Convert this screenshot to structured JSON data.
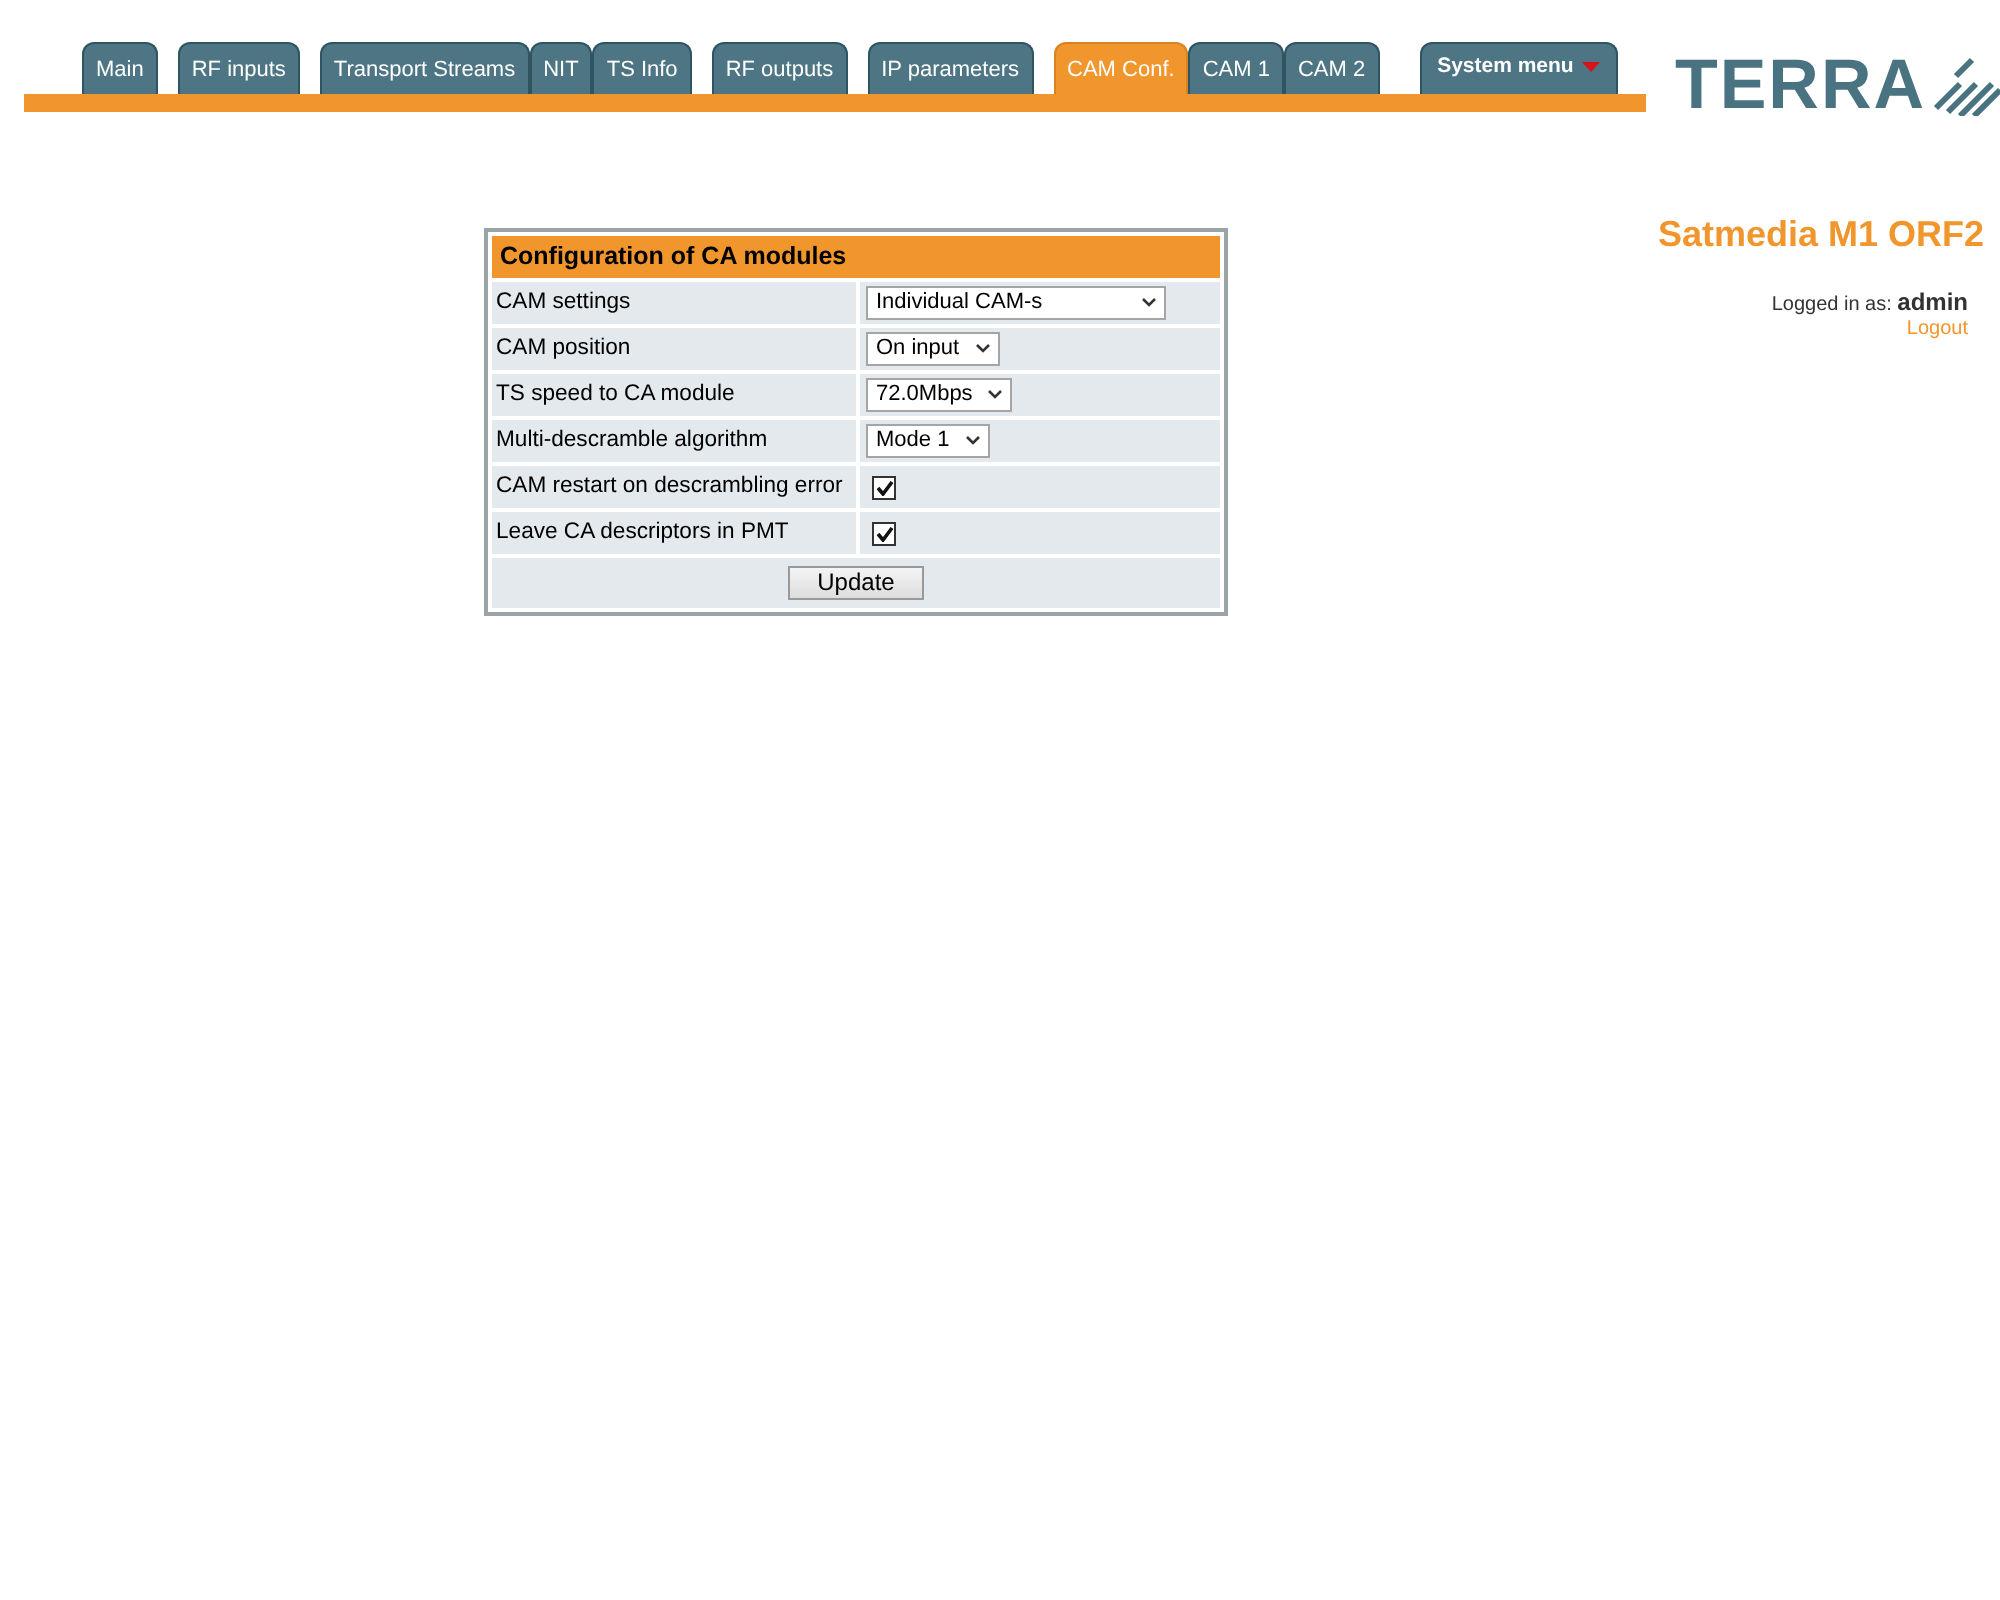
{
  "tab_groups": [
    [
      {
        "label": "Main",
        "selected": false
      }
    ],
    [
      {
        "label": "RF inputs",
        "selected": false
      }
    ],
    [
      {
        "label": "Transport Streams",
        "selected": false
      },
      {
        "label": "NIT",
        "selected": false
      },
      {
        "label": "TS Info",
        "selected": false
      }
    ],
    [
      {
        "label": "RF outputs",
        "selected": false
      }
    ],
    [
      {
        "label": "IP parameters",
        "selected": false
      }
    ],
    [
      {
        "label": "CAM Conf.",
        "selected": true
      },
      {
        "label": "CAM 1",
        "selected": false
      },
      {
        "label": "CAM 2",
        "selected": false
      }
    ]
  ],
  "system_menu": {
    "label": "System menu"
  },
  "logo": {
    "text": "TERRA"
  },
  "device_name": "Satmedia M1 ORF2",
  "login": {
    "text": "Logged in as: **admin**",
    "logout": "Logout"
  },
  "panel": {
    "title": "Configuration of CA modules",
    "rows": [
      {
        "kind": "select",
        "label": "CAM settings",
        "value": "Individual CAM-s",
        "wide": true
      },
      {
        "kind": "select",
        "label": "CAM position",
        "value": "On input",
        "wide": false
      },
      {
        "kind": "select",
        "label": "TS speed to CA module",
        "value": "72.0Mbps",
        "wide": false
      },
      {
        "kind": "select",
        "label": "Multi-descramble algorithm",
        "value": "Mode 1",
        "wide": false
      },
      {
        "kind": "checkbox",
        "label": "CAM restart on descrambling error",
        "checked": true
      },
      {
        "kind": "checkbox",
        "label": "Leave CA descriptors in PMT",
        "checked": true
      }
    ],
    "button": "Update"
  }
}
